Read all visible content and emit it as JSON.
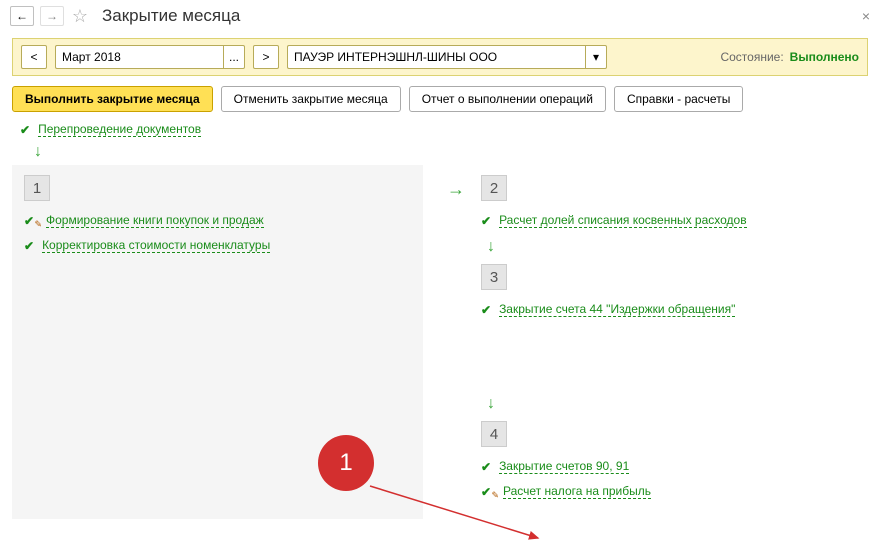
{
  "titlebar": {
    "title": "Закрытие месяца"
  },
  "toolbar": {
    "prev": "<",
    "next": ">",
    "pick": "...",
    "drop": "▾",
    "period": "Март 2018",
    "org": "ПАУЭР ИНТЕРНЭШНЛ-ШИНЫ ООО",
    "state_label": "Состояние:",
    "state_value": "Выполнено"
  },
  "actions": {
    "execute": "Выполнить закрытие месяца",
    "cancel": "Отменить закрытие месяца",
    "report": "Отчет о выполнении операций",
    "refs": "Справки - расчеты"
  },
  "pre": {
    "label": "Перепроведение документов"
  },
  "left": {
    "num": "1",
    "items": [
      "Формирование книги покупок и продаж",
      "Корректировка стоимости номенклатуры"
    ]
  },
  "right": {
    "sect2": {
      "num": "2",
      "item": "Расчет долей списания косвенных расходов"
    },
    "sect3": {
      "num": "3",
      "item": "Закрытие счета 44 \"Издержки обращения\""
    },
    "sect4": {
      "num": "4",
      "items": [
        "Закрытие счетов 90, 91",
        "Расчет налога на прибыль"
      ]
    }
  },
  "callout": {
    "num": "1"
  }
}
